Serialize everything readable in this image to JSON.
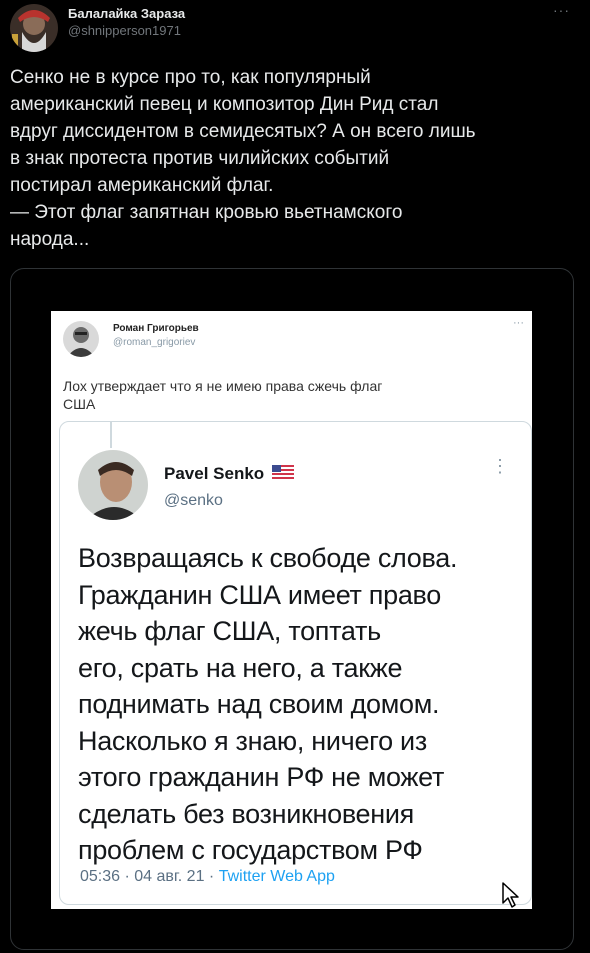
{
  "author": {
    "name": "Балалайка Зараза",
    "handle": "@shnipperson1971"
  },
  "tweet_text": "Сенко не в курсе про то, как популярный\nамериканский певец и композитор Дин Рид стал\nвдруг диссидентом в семидесятых? А он всего лишь\nв знак протеста против чилийских событий\nпостирал американский флаг.\n— Этот флаг запятнан кровью вьетнамского\nнарода...",
  "screenshot": {
    "author_name": "Роман Григорьев",
    "author_handle": "@roman_grigoriev",
    "text": "Лох утверждает что я не имею права сжечь флаг\nСША",
    "quoted": {
      "name": "Pavel Senko",
      "handle": "@senko",
      "text": "Возвращаясь к свободе слова.\nГражданин США имеет право\nжечь флаг США, топтать\nего, срать на него, а также\nподнимать над своим домом.\nНасколько я знаю, ничего из\nэтого гражданин РФ не может\nсделать без возникновения\nпроблем с государством РФ",
      "time": "05:36 · 04 авг. 21 · ",
      "app": "Twitter Web App",
      "flag_icon": "us-flag-icon"
    }
  },
  "icons": {
    "more": "more-icon",
    "cursor": "mouse-cursor-icon"
  }
}
